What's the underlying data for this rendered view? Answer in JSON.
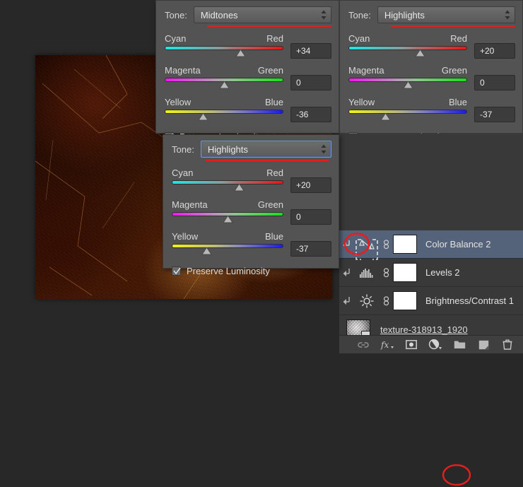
{
  "app": {
    "accent_red": "#e02020",
    "panel_bg": "#535353",
    "dock_bg": "#393939",
    "selected_row_bg": "#55637a"
  },
  "canvas": {
    "name": "document-canvas",
    "description": "dark brown grunge texture image"
  },
  "panels": [
    {
      "id": "midtones",
      "tone_label": "Tone:",
      "tone_value": "Midtones",
      "focused": false,
      "sliders": [
        {
          "left": "Cyan",
          "right": "Red",
          "value": "+34",
          "pos": 64
        },
        {
          "left": "Magenta",
          "right": "Green",
          "value": "0",
          "pos": 50
        },
        {
          "left": "Yellow",
          "right": "Blue",
          "value": "-36",
          "pos": 32
        }
      ],
      "preserve_label": "Preserve Luminosity",
      "preserve_checked": true
    },
    {
      "id": "highlights-top",
      "tone_label": "Tone:",
      "tone_value": "Highlights",
      "focused": false,
      "sliders": [
        {
          "left": "Cyan",
          "right": "Red",
          "value": "+20",
          "pos": 60
        },
        {
          "left": "Magenta",
          "right": "Green",
          "value": "0",
          "pos": 50
        },
        {
          "left": "Yellow",
          "right": "Blue",
          "value": "-37",
          "pos": 31
        }
      ],
      "preserve_label": "Preserve Luminosity",
      "preserve_checked": true
    },
    {
      "id": "highlights-float",
      "tone_label": "Tone:",
      "tone_value": "Highlights",
      "focused": true,
      "sliders": [
        {
          "left": "Cyan",
          "right": "Red",
          "value": "+20",
          "pos": 60
        },
        {
          "left": "Magenta",
          "right": "Green",
          "value": "0",
          "pos": 50
        },
        {
          "left": "Yellow",
          "right": "Blue",
          "value": "-37",
          "pos": 31
        }
      ],
      "preserve_label": "Preserve Luminosity",
      "preserve_checked": true
    }
  ],
  "layers": {
    "rows": [
      {
        "name": "Color Balance 2",
        "icon": "color-balance-scales-icon",
        "selected": true,
        "clipped": true,
        "linked": true,
        "mask": true
      },
      {
        "name": "Levels 2",
        "icon": "levels-histogram-icon",
        "selected": false,
        "clipped": true,
        "linked": true,
        "mask": true
      },
      {
        "name": "Brightness/Contrast 1",
        "icon": "brightness-sun-icon",
        "selected": false,
        "clipped": true,
        "linked": true,
        "mask": true
      }
    ],
    "background": {
      "name": "texture-318913_1920",
      "thumb": "grayscale-noise-thumbnail",
      "smart_object_badge": true
    },
    "toolbar": [
      {
        "name": "link-layers-icon",
        "label": "link"
      },
      {
        "name": "layer-styles-fx-icon",
        "label": "fx"
      },
      {
        "name": "add-layer-mask-icon",
        "label": "mask"
      },
      {
        "name": "adjustment-layer-icon",
        "label": "adjustment",
        "highlighted": true
      },
      {
        "name": "new-group-folder-icon",
        "label": "group"
      },
      {
        "name": "new-layer-icon",
        "label": "new layer"
      },
      {
        "name": "delete-layer-trash-icon",
        "label": "delete"
      }
    ]
  },
  "annotations": {
    "clip_arrow_circle": "red ellipse highlighting clipping-mask arrow on Color Balance 2",
    "adjustment_button_circle": "red ellipse highlighting adjustment layer button"
  }
}
